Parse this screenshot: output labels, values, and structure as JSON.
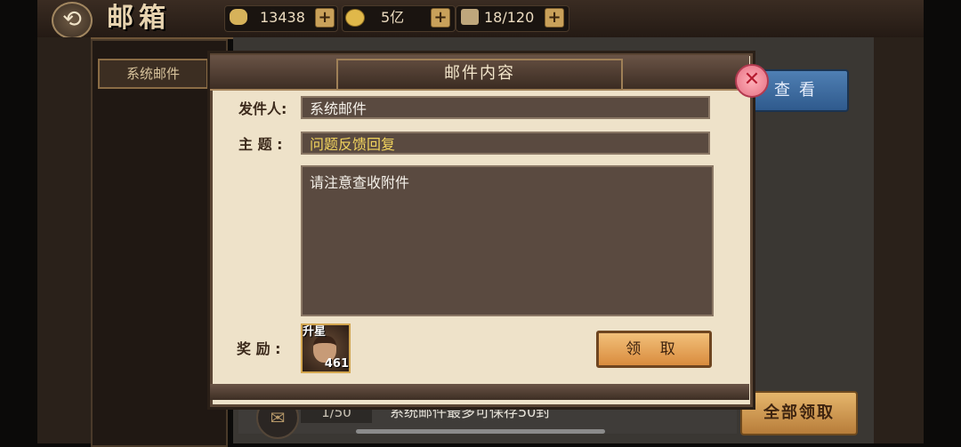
{
  "header": {
    "title": "邮箱",
    "resources": [
      {
        "icon": "ingot-icon",
        "value": "13438"
      },
      {
        "icon": "coin-icon",
        "value": "5亿"
      },
      {
        "icon": "stamina-icon",
        "value": "18/120"
      }
    ]
  },
  "sidebar": {
    "tab_label": "系统邮件"
  },
  "list": {
    "view_label": "查看"
  },
  "dialog": {
    "title": "邮件内容",
    "sender_label": "发件人:",
    "sender_value": "系统邮件",
    "subject_label": "主  题 :",
    "subject_value": "问题反馈回复",
    "body": "请注意查收附件",
    "reward_label": "奖  励 :",
    "reward_item": {
      "badge": "升星",
      "count": "461"
    },
    "claim_label": "领 取",
    "close_icon": "close-icon"
  },
  "footer": {
    "count": "1/50",
    "limit_text": "系统邮件最多可保存50封",
    "collect_all_label": "全部领取"
  }
}
